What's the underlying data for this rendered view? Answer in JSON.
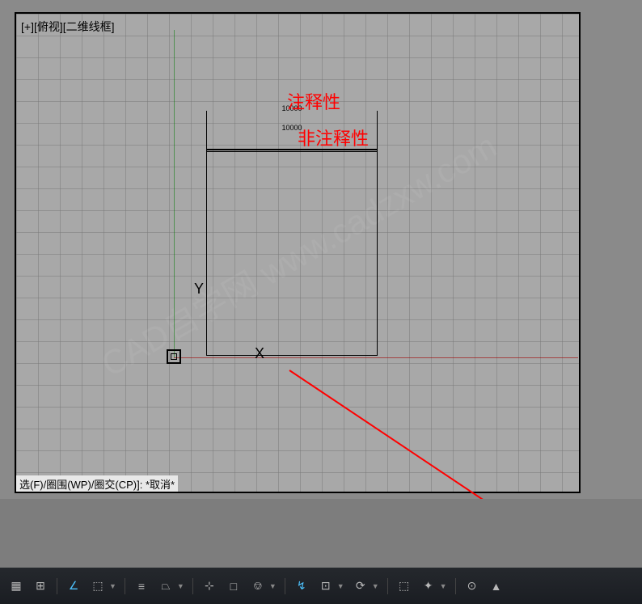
{
  "view": {
    "label": "[+][俯视][二维线框]",
    "axis_x": "X",
    "axis_y": "Y"
  },
  "dimensions": {
    "dim1_value": "10000",
    "dim2_value": "10000"
  },
  "annotations": {
    "label1": "注释性",
    "label2": "非注释性"
  },
  "command": {
    "text": "选(F)/圈围(WP)/圈交(CP)]: *取消*"
  },
  "watermark": "CAD自学网 www.cadzxw.com",
  "statusbar": {
    "buttons": [
      {
        "name": "model",
        "icon": "▦",
        "active": false
      },
      {
        "name": "grid",
        "icon": "⊞",
        "active": false
      },
      {
        "name": "snap",
        "icon": "∠",
        "active": true
      },
      {
        "name": "ortho",
        "icon": "⬚",
        "active": false
      },
      {
        "name": "polar",
        "icon": "≡",
        "active": false
      },
      {
        "name": "iso",
        "icon": "⏢",
        "active": false
      },
      {
        "name": "osnap",
        "icon": "⊹",
        "active": false
      },
      {
        "name": "3dosnap",
        "icon": "□",
        "active": false
      },
      {
        "name": "otrack",
        "icon": "⎊",
        "active": false
      },
      {
        "name": "dyn",
        "icon": "↯",
        "active": true
      },
      {
        "name": "lwt",
        "icon": "⊡",
        "active": false
      },
      {
        "name": "cycle",
        "icon": "⟳",
        "active": false
      },
      {
        "name": "sel",
        "icon": "⬚",
        "active": false
      },
      {
        "name": "gizmo",
        "icon": "✦",
        "active": false
      },
      {
        "name": "anno-vis",
        "icon": "⊙",
        "active": false
      },
      {
        "name": "anno-scale",
        "icon": "▲",
        "active": false
      }
    ]
  }
}
